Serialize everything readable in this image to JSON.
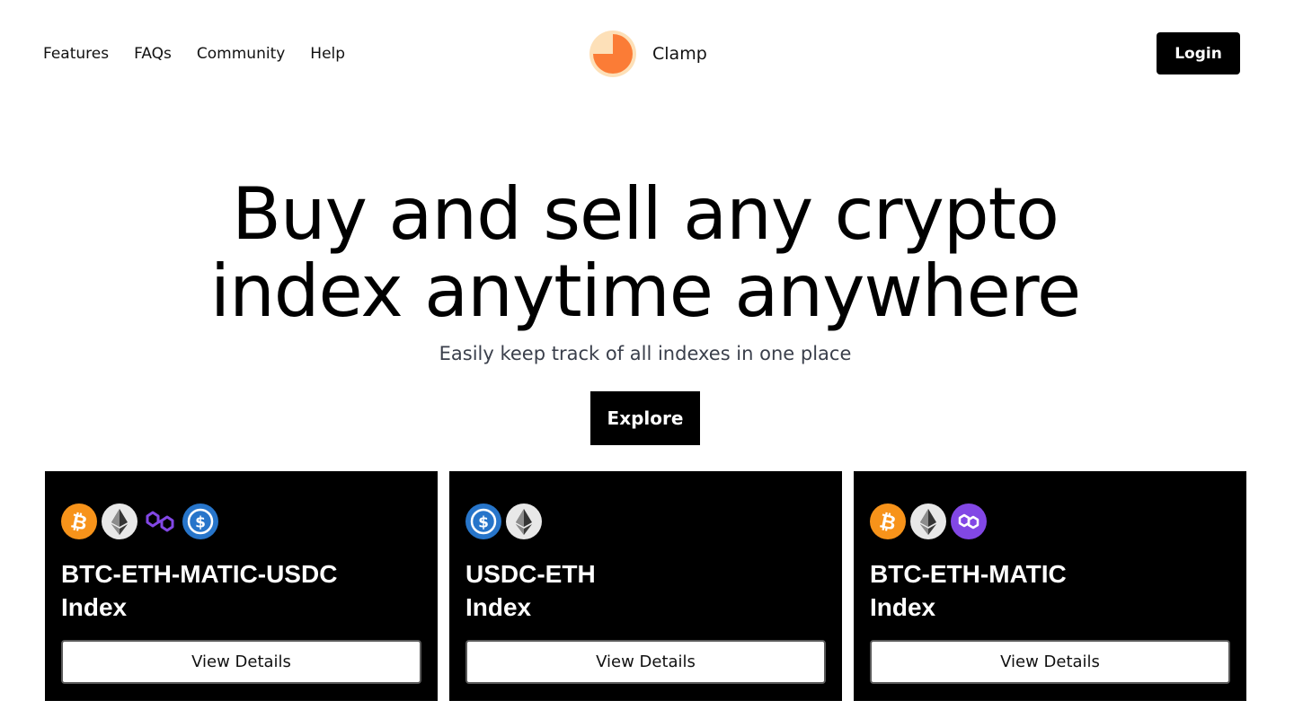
{
  "nav": {
    "items": [
      {
        "label": "Features"
      },
      {
        "label": "FAQs"
      },
      {
        "label": "Community"
      },
      {
        "label": "Help"
      }
    ]
  },
  "brand": {
    "name": "Clamp",
    "logo_icon": "pie-chart-icon",
    "logo_colors": {
      "background": "#fde0b8",
      "slice": "#fb7c36"
    }
  },
  "header": {
    "login_label": "Login"
  },
  "hero": {
    "title_line1": "Buy and sell any crypto",
    "title_line2": "index anytime anywhere",
    "subtitle": "Easily keep track of all indexes in one place",
    "cta_label": "Explore"
  },
  "cards": [
    {
      "title_line1": "BTC-ETH-MATIC-USDC",
      "title_line2": "Index",
      "coins": [
        "bitcoin-icon",
        "ethereum-icon",
        "polygon-icon",
        "usdc-icon"
      ],
      "button_label": "View Details"
    },
    {
      "title_line1": "USDC-ETH",
      "title_line2": "Index",
      "coins": [
        "usdc-icon",
        "ethereum-icon"
      ],
      "button_label": "View Details"
    },
    {
      "title_line1": "BTC-ETH-MATIC",
      "title_line2": "Index",
      "coins": [
        "bitcoin-icon",
        "ethereum-icon",
        "polygon-icon"
      ],
      "button_label": "View Details"
    }
  ],
  "colors": {
    "bitcoin": "#f7931a",
    "ethereum_bg": "#e8e8e8",
    "polygon_outline": "#8247e5",
    "polygon_badge": "#8247e5",
    "usdc": "#2775ca",
    "card_bg": "#000000",
    "primary_button": "#000000"
  }
}
